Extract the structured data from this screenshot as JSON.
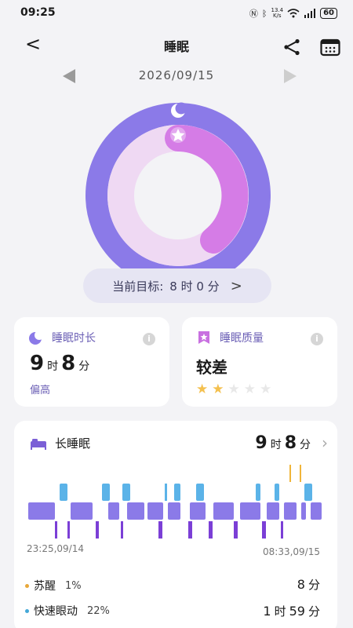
{
  "status": {
    "time": "09:25",
    "net_speed_top": "13.4",
    "net_speed_bottom": "K/s",
    "battery": "60"
  },
  "header": {
    "title": "睡眠",
    "back": "<"
  },
  "date": "2026/09/15",
  "goal": {
    "label": "当前目标:",
    "value": "8 时 0 分",
    "chevron": ">"
  },
  "duration": {
    "label": "睡眠时长",
    "hours": "9",
    "hours_unit": "时",
    "minutes": "8",
    "minutes_unit": "分",
    "status": "偏高"
  },
  "quality": {
    "label": "睡眠质量",
    "value": "较差",
    "stars_filled": 2,
    "stars_total": 5
  },
  "long_sleep": {
    "label": "长睡眠",
    "hours": "9",
    "hours_unit": "时",
    "minutes": "8",
    "minutes_unit": "分",
    "start": "23:25,09/14",
    "end": "08:33,09/15",
    "stages": [
      {
        "name": "苏醒",
        "percent": "1%",
        "duration_n": "8",
        "duration_u": "分",
        "color": "#e8a83a"
      },
      {
        "name": "快速眼动",
        "percent": "22%",
        "duration_h": "1",
        "duration_hu": "时",
        "duration_m": "59",
        "duration_mu": "分",
        "color": "#44a8d8"
      }
    ]
  },
  "colors": {
    "accent": "#6b5fb5",
    "deep": "#7b3fd6",
    "light": "#8b7ae8",
    "rem": "#5bb3e8",
    "awake": "#f0b53a",
    "star": "#f4c04e",
    "star_empty": "#e6e6e6"
  }
}
